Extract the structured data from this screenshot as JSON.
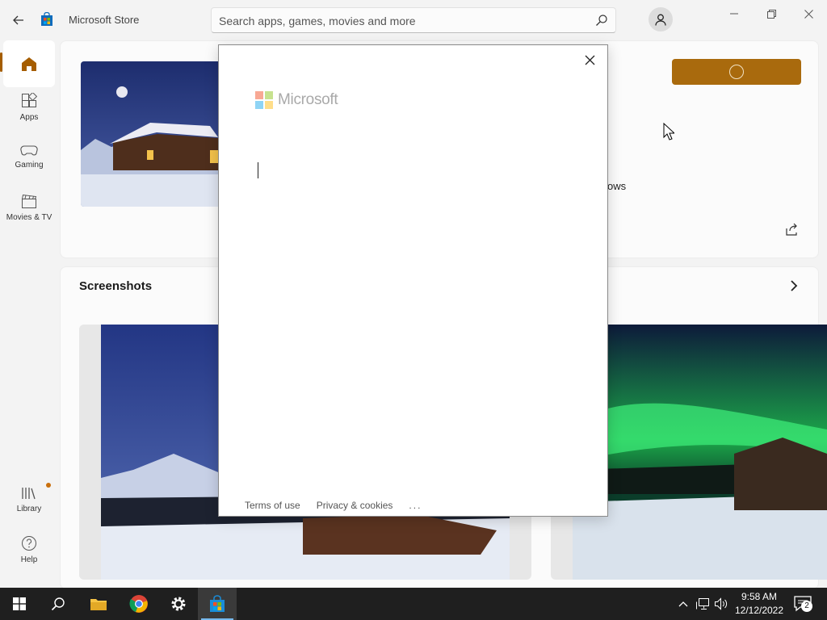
{
  "window": {
    "title": "Microsoft Store",
    "back_icon": "back-arrow-icon",
    "minimize_icon": "minimize-icon",
    "restore_icon": "restore-icon",
    "close_icon": "close-icon"
  },
  "search": {
    "placeholder": "Search apps, games, movies and more",
    "value": ""
  },
  "sidebar": {
    "items": [
      {
        "label": "",
        "icon": "home-icon"
      },
      {
        "label": "Apps",
        "icon": "apps-icon"
      },
      {
        "label": "Gaming",
        "icon": "gamepad-icon"
      },
      {
        "label": "Movies & TV",
        "icon": "clapperboard-icon"
      },
      {
        "label": "Library",
        "icon": "library-icon"
      },
      {
        "label": "Help",
        "icon": "help-icon"
      }
    ]
  },
  "product": {
    "description_fragment": "ows",
    "get_button_color": "#a96a0d"
  },
  "screenshots": {
    "title": "Screenshots"
  },
  "dialog": {
    "brand": "Microsoft",
    "footer": {
      "terms": "Terms of use",
      "privacy": "Privacy & cookies",
      "more": "..."
    }
  },
  "taskbar": {
    "time": "9:58 AM",
    "date": "12/12/2022",
    "notification_count": "2"
  },
  "colors": {
    "accent": "#a96a0d",
    "taskbar": "#1f1f1f"
  }
}
